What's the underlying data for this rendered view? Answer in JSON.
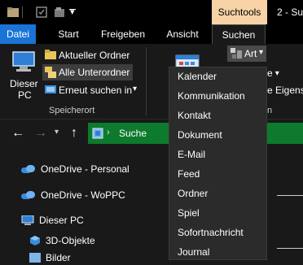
{
  "titlebar": {
    "contextual_tab": "Suchtools",
    "window_title": "2 - Su"
  },
  "tabs": [
    {
      "label": "Datei"
    },
    {
      "label": "Start"
    },
    {
      "label": "Freigeben"
    },
    {
      "label": "Ansicht"
    },
    {
      "label": "Suchen"
    }
  ],
  "ribbon": {
    "this_pc_line1": "Dieser",
    "this_pc_line2": "PC",
    "current_folder": "Aktueller Ordner",
    "all_subfolders": "Alle Unterordner",
    "search_again_in": "Erneut suchen in",
    "group_location": "Speicherort",
    "kind_button": "Art",
    "partial_label_1": "e",
    "partial_label_2": "e Eigens",
    "partial_label_3": "n"
  },
  "address": {
    "text": "Suche"
  },
  "tree": [
    {
      "label": "OneDrive - Personal"
    },
    {
      "label": "OneDrive - WoPPC"
    },
    {
      "label": "Dieser PC"
    },
    {
      "label": "3D-Objekte"
    },
    {
      "label": "Bilder"
    }
  ],
  "kind_menu": [
    {
      "label": "Kalender"
    },
    {
      "label": "Kommunikation"
    },
    {
      "label": "Kontakt"
    },
    {
      "label": "Dokument"
    },
    {
      "label": "E-Mail"
    },
    {
      "label": "Feed"
    },
    {
      "label": "Ordner"
    },
    {
      "label": "Spiel"
    },
    {
      "label": "Sofortnachricht"
    },
    {
      "label": "Journal"
    }
  ],
  "colors": {
    "file_tab": "#1a73d6",
    "contextual_tab": "#f7d3a6",
    "address_bar": "#0d7a2e",
    "menu_bg": "#2b2b2b"
  }
}
